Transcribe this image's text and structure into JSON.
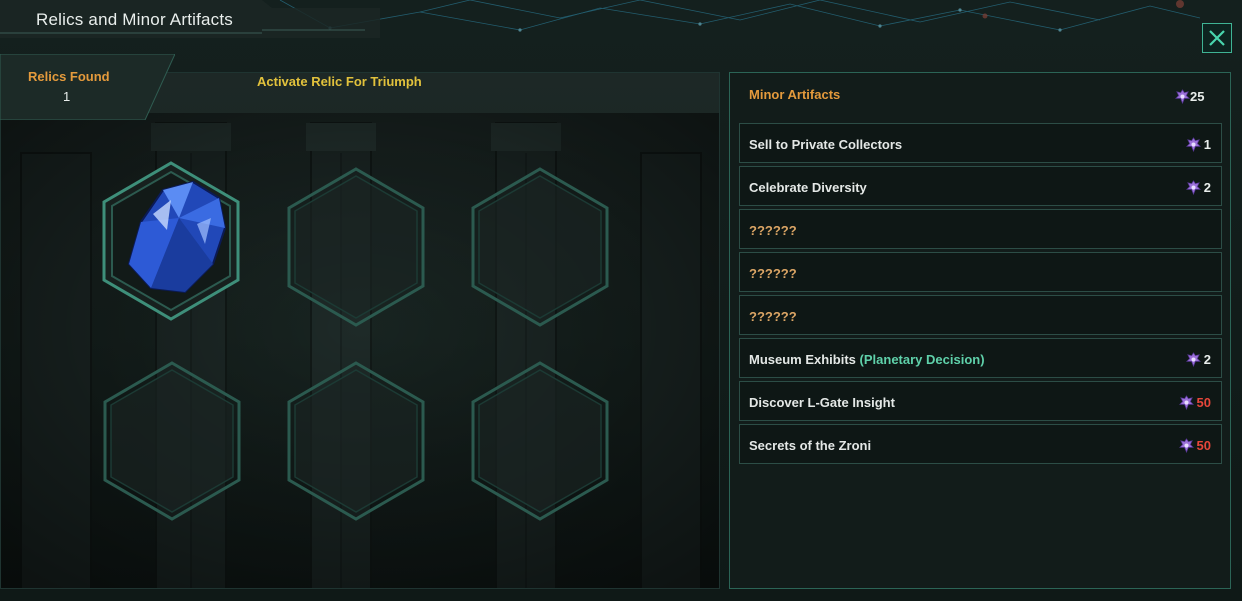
{
  "window": {
    "title": "Relics and Minor Artifacts",
    "close_label": "close"
  },
  "relics": {
    "found_label": "Relics Found",
    "found_count": "1",
    "activate_label": "Activate Relic For Triumph",
    "slots": [
      {
        "filled": true,
        "item_icon": "blue-crystal-relic-icon"
      },
      {
        "filled": false
      },
      {
        "filled": false
      },
      {
        "filled": false
      },
      {
        "filled": false
      },
      {
        "filled": false
      }
    ]
  },
  "artifacts": {
    "header": "Minor Artifacts",
    "total": "25",
    "icon": "minor-artifact-icon",
    "items": [
      {
        "label": "Sell to Private Collectors",
        "cost": "1",
        "known": true
      },
      {
        "label": "Celebrate Diversity",
        "cost": "2",
        "known": true
      },
      {
        "label": "??????",
        "cost": "",
        "known": false
      },
      {
        "label": "??????",
        "cost": "",
        "known": false
      },
      {
        "label": "??????",
        "cost": "",
        "known": false
      },
      {
        "label": "Museum Exhibits",
        "sublabel": "(Planetary Decision)",
        "cost": "2",
        "known": true
      },
      {
        "label": "Discover L-Gate Insight",
        "cost": "50",
        "known": true,
        "unaffordable": true
      },
      {
        "label": "Secrets of the Zroni",
        "cost": "50",
        "known": true,
        "unaffordable": true
      }
    ]
  },
  "colors": {
    "accent": "#3fb394",
    "header_orange": "#e49a3c",
    "activate_yellow": "#e2c23c",
    "unaffordable_red": "#e5463a",
    "decision_green": "#5fd1aa",
    "artifact_purple": "#9b6fd8"
  }
}
